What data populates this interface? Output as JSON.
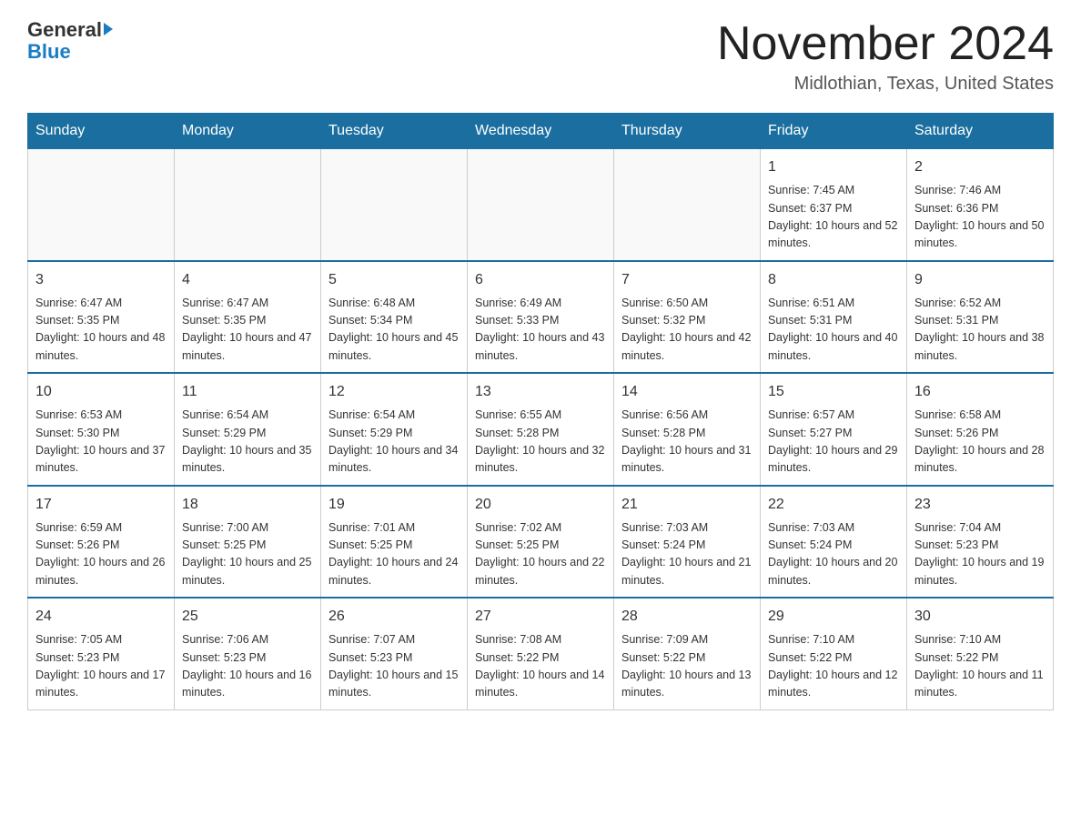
{
  "logo": {
    "text_general": "General",
    "text_blue": "Blue"
  },
  "header": {
    "month_title": "November 2024",
    "location": "Midlothian, Texas, United States"
  },
  "days_of_week": [
    "Sunday",
    "Monday",
    "Tuesday",
    "Wednesday",
    "Thursday",
    "Friday",
    "Saturday"
  ],
  "weeks": [
    {
      "days": [
        {
          "number": "",
          "info": ""
        },
        {
          "number": "",
          "info": ""
        },
        {
          "number": "",
          "info": ""
        },
        {
          "number": "",
          "info": ""
        },
        {
          "number": "",
          "info": ""
        },
        {
          "number": "1",
          "info": "Sunrise: 7:45 AM\nSunset: 6:37 PM\nDaylight: 10 hours and 52 minutes."
        },
        {
          "number": "2",
          "info": "Sunrise: 7:46 AM\nSunset: 6:36 PM\nDaylight: 10 hours and 50 minutes."
        }
      ]
    },
    {
      "days": [
        {
          "number": "3",
          "info": "Sunrise: 6:47 AM\nSunset: 5:35 PM\nDaylight: 10 hours and 48 minutes."
        },
        {
          "number": "4",
          "info": "Sunrise: 6:47 AM\nSunset: 5:35 PM\nDaylight: 10 hours and 47 minutes."
        },
        {
          "number": "5",
          "info": "Sunrise: 6:48 AM\nSunset: 5:34 PM\nDaylight: 10 hours and 45 minutes."
        },
        {
          "number": "6",
          "info": "Sunrise: 6:49 AM\nSunset: 5:33 PM\nDaylight: 10 hours and 43 minutes."
        },
        {
          "number": "7",
          "info": "Sunrise: 6:50 AM\nSunset: 5:32 PM\nDaylight: 10 hours and 42 minutes."
        },
        {
          "number": "8",
          "info": "Sunrise: 6:51 AM\nSunset: 5:31 PM\nDaylight: 10 hours and 40 minutes."
        },
        {
          "number": "9",
          "info": "Sunrise: 6:52 AM\nSunset: 5:31 PM\nDaylight: 10 hours and 38 minutes."
        }
      ]
    },
    {
      "days": [
        {
          "number": "10",
          "info": "Sunrise: 6:53 AM\nSunset: 5:30 PM\nDaylight: 10 hours and 37 minutes."
        },
        {
          "number": "11",
          "info": "Sunrise: 6:54 AM\nSunset: 5:29 PM\nDaylight: 10 hours and 35 minutes."
        },
        {
          "number": "12",
          "info": "Sunrise: 6:54 AM\nSunset: 5:29 PM\nDaylight: 10 hours and 34 minutes."
        },
        {
          "number": "13",
          "info": "Sunrise: 6:55 AM\nSunset: 5:28 PM\nDaylight: 10 hours and 32 minutes."
        },
        {
          "number": "14",
          "info": "Sunrise: 6:56 AM\nSunset: 5:28 PM\nDaylight: 10 hours and 31 minutes."
        },
        {
          "number": "15",
          "info": "Sunrise: 6:57 AM\nSunset: 5:27 PM\nDaylight: 10 hours and 29 minutes."
        },
        {
          "number": "16",
          "info": "Sunrise: 6:58 AM\nSunset: 5:26 PM\nDaylight: 10 hours and 28 minutes."
        }
      ]
    },
    {
      "days": [
        {
          "number": "17",
          "info": "Sunrise: 6:59 AM\nSunset: 5:26 PM\nDaylight: 10 hours and 26 minutes."
        },
        {
          "number": "18",
          "info": "Sunrise: 7:00 AM\nSunset: 5:25 PM\nDaylight: 10 hours and 25 minutes."
        },
        {
          "number": "19",
          "info": "Sunrise: 7:01 AM\nSunset: 5:25 PM\nDaylight: 10 hours and 24 minutes."
        },
        {
          "number": "20",
          "info": "Sunrise: 7:02 AM\nSunset: 5:25 PM\nDaylight: 10 hours and 22 minutes."
        },
        {
          "number": "21",
          "info": "Sunrise: 7:03 AM\nSunset: 5:24 PM\nDaylight: 10 hours and 21 minutes."
        },
        {
          "number": "22",
          "info": "Sunrise: 7:03 AM\nSunset: 5:24 PM\nDaylight: 10 hours and 20 minutes."
        },
        {
          "number": "23",
          "info": "Sunrise: 7:04 AM\nSunset: 5:23 PM\nDaylight: 10 hours and 19 minutes."
        }
      ]
    },
    {
      "days": [
        {
          "number": "24",
          "info": "Sunrise: 7:05 AM\nSunset: 5:23 PM\nDaylight: 10 hours and 17 minutes."
        },
        {
          "number": "25",
          "info": "Sunrise: 7:06 AM\nSunset: 5:23 PM\nDaylight: 10 hours and 16 minutes."
        },
        {
          "number": "26",
          "info": "Sunrise: 7:07 AM\nSunset: 5:23 PM\nDaylight: 10 hours and 15 minutes."
        },
        {
          "number": "27",
          "info": "Sunrise: 7:08 AM\nSunset: 5:22 PM\nDaylight: 10 hours and 14 minutes."
        },
        {
          "number": "28",
          "info": "Sunrise: 7:09 AM\nSunset: 5:22 PM\nDaylight: 10 hours and 13 minutes."
        },
        {
          "number": "29",
          "info": "Sunrise: 7:10 AM\nSunset: 5:22 PM\nDaylight: 10 hours and 12 minutes."
        },
        {
          "number": "30",
          "info": "Sunrise: 7:10 AM\nSunset: 5:22 PM\nDaylight: 10 hours and 11 minutes."
        }
      ]
    }
  ]
}
